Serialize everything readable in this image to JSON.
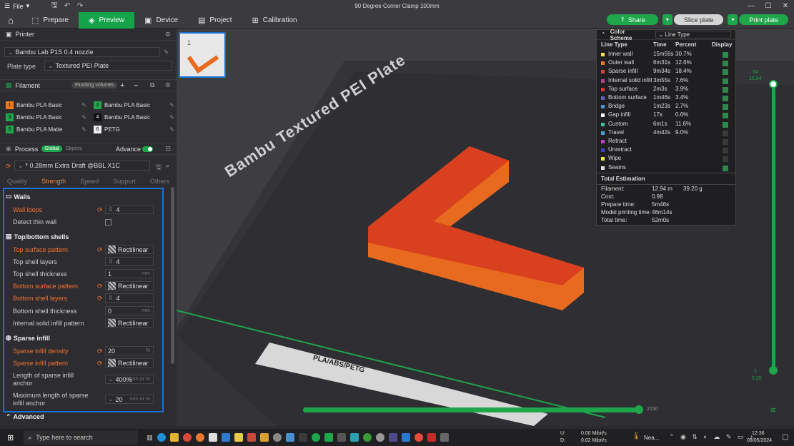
{
  "window": {
    "title": "90 Degree Corner Clamp 100mm",
    "menu": "File"
  },
  "tabs": [
    {
      "label": "Prepare"
    },
    {
      "label": "Preview"
    },
    {
      "label": "Device"
    },
    {
      "label": "Project"
    },
    {
      "label": "Calibration"
    }
  ],
  "actions": {
    "share": "Share",
    "slice": "Slice plate",
    "print": "Print plate"
  },
  "printer": {
    "section": "Printer",
    "name": "Bambu Lab P1S 0.4 nozzle",
    "plate_label": "Plate type",
    "plate": "Textured PEI Plate"
  },
  "filament": {
    "section": "Filament",
    "flushing": "Flushing volumes",
    "items": [
      {
        "num": "1",
        "name": "Bambu PLA Basic",
        "color": "#f07a1a"
      },
      {
        "num": "2",
        "name": "Bambu PLA Basic",
        "color": "#1fa64b"
      },
      {
        "num": "3",
        "name": "Bambu PLA Basic",
        "color": "#1fa64b"
      },
      {
        "num": "4",
        "name": "Bambu PLA Basic",
        "color": "#111111"
      },
      {
        "num": "5",
        "name": "Bambu PLA Matte",
        "color": "#1fa64b"
      },
      {
        "num": "6",
        "name": "PETG",
        "color": "#eeeeee"
      }
    ]
  },
  "process": {
    "section": "Process",
    "global": "Global",
    "objects": "Objects",
    "advance": "Advance",
    "preset": "* 0.28mm Extra Draft @BBL X1C",
    "tabs": [
      "Quality",
      "Strength",
      "Speed",
      "Support",
      "Others"
    ]
  },
  "settings": {
    "walls": "Walls",
    "wall_loops": {
      "label": "Wall loops",
      "value": "4"
    },
    "detect_thin": {
      "label": "Detect thin wall"
    },
    "topbottom": "Top/bottom shells",
    "top_pattern": {
      "label": "Top surface pattern",
      "value": "Rectilinear"
    },
    "top_layers": {
      "label": "Top shell layers",
      "value": "4"
    },
    "top_thick": {
      "label": "Top shell thickness",
      "value": "1",
      "unit": "mm"
    },
    "bottom_pattern": {
      "label": "Bottom surface pattern",
      "value": "Rectilinear"
    },
    "bottom_layers": {
      "label": "Bottom shell layers",
      "value": "4"
    },
    "bottom_thick": {
      "label": "Bottom shell thickness",
      "value": "0",
      "unit": "mm"
    },
    "internal_pattern": {
      "label": "Internal solid infill pattern",
      "value": "Rectilinear"
    },
    "sparse": "Sparse infill",
    "density": {
      "label": "Sparse infill density",
      "value": "20",
      "unit": "%"
    },
    "sparse_pattern": {
      "label": "Sparse infill pattern",
      "value": "Rectilinear"
    },
    "anchor": {
      "label1": "Length of sparse infill",
      "label2": "anchor",
      "value": "400%",
      "unit": "mm or %"
    },
    "max_anchor": {
      "label1": "Maximum length of sparse",
      "label2": "infill anchor",
      "value": "20",
      "unit": "mm or %"
    },
    "advanced": "Advanced"
  },
  "plate": {
    "thumb_num": "1",
    "bed_text": "Bambu Textured PEI Plate",
    "bed_bottom": "PLA/ABS/PETG"
  },
  "layer_slider": {
    "top": "54",
    "top2": "15.04",
    "bottom": "1",
    "bottom2": "0.20",
    "h_right": "2150"
  },
  "legend": {
    "scheme": "Color Scheme",
    "type": "Line Type",
    "headers": [
      "Line Type",
      "Time",
      "Percent",
      "Display"
    ],
    "rows": [
      {
        "name": "Inner wall",
        "time": "15m59s",
        "pct": "30.7%",
        "color": "#f5e04a",
        "on": true
      },
      {
        "name": "Outer wall",
        "time": "6m31s",
        "pct": "12.6%",
        "color": "#f07a1a",
        "on": true
      },
      {
        "name": "Sparse infill",
        "time": "9m34s",
        "pct": "18.4%",
        "color": "#d04040",
        "on": true
      },
      {
        "name": "Internal solid infill",
        "time": "3m55s",
        "pct": "7.6%",
        "color": "#b04090",
        "on": true
      },
      {
        "name": "Top surface",
        "time": "2m3s",
        "pct": "3.9%",
        "color": "#e03030",
        "on": true
      },
      {
        "name": "Bottom surface",
        "time": "1m46s",
        "pct": "3.4%",
        "color": "#6060c0",
        "on": true
      },
      {
        "name": "Bridge",
        "time": "1m23s",
        "pct": "2.7%",
        "color": "#5090d0",
        "on": true
      },
      {
        "name": "Gap infill",
        "time": "17s",
        "pct": "0.6%",
        "color": "#ffffff",
        "on": true
      },
      {
        "name": "Custom",
        "time": "6m1s",
        "pct": "11.6%",
        "color": "#40c0a0",
        "on": true
      },
      {
        "name": "Travel",
        "time": "4m42s",
        "pct": "9.0%",
        "color": "#40a0d0",
        "on": false
      },
      {
        "name": "Retract",
        "time": "",
        "pct": "",
        "color": "#c040c0",
        "on": false
      },
      {
        "name": "Unretract",
        "time": "",
        "pct": "",
        "color": "#4040d0",
        "on": false
      },
      {
        "name": "Wipe",
        "time": "",
        "pct": "",
        "color": "#f0f040",
        "on": false
      },
      {
        "name": "Seams",
        "time": "",
        "pct": "",
        "color": "#e0e0e0",
        "on": true
      }
    ],
    "total_title": "Total Estimation",
    "filament_label": "Filament:",
    "filament_m": "12.94 m",
    "filament_g": "39.20 g",
    "cost_label": "Cost:",
    "cost": "0.98",
    "prep_label": "Prepare time:",
    "prep": "5m46s",
    "model_label": "Model printing time:",
    "model": "46m14s",
    "total_label": "Total time:",
    "total": "52m0s"
  },
  "taskbar": {
    "search": "Type here to search",
    "net_u": "U:",
    "net_u_val": "0.00 Mibit/s",
    "net_d": "D:",
    "net_d_val": "0.02 Mibit/s",
    "weather": "Nea...",
    "time": "12:36",
    "date": "08/05/2024"
  }
}
